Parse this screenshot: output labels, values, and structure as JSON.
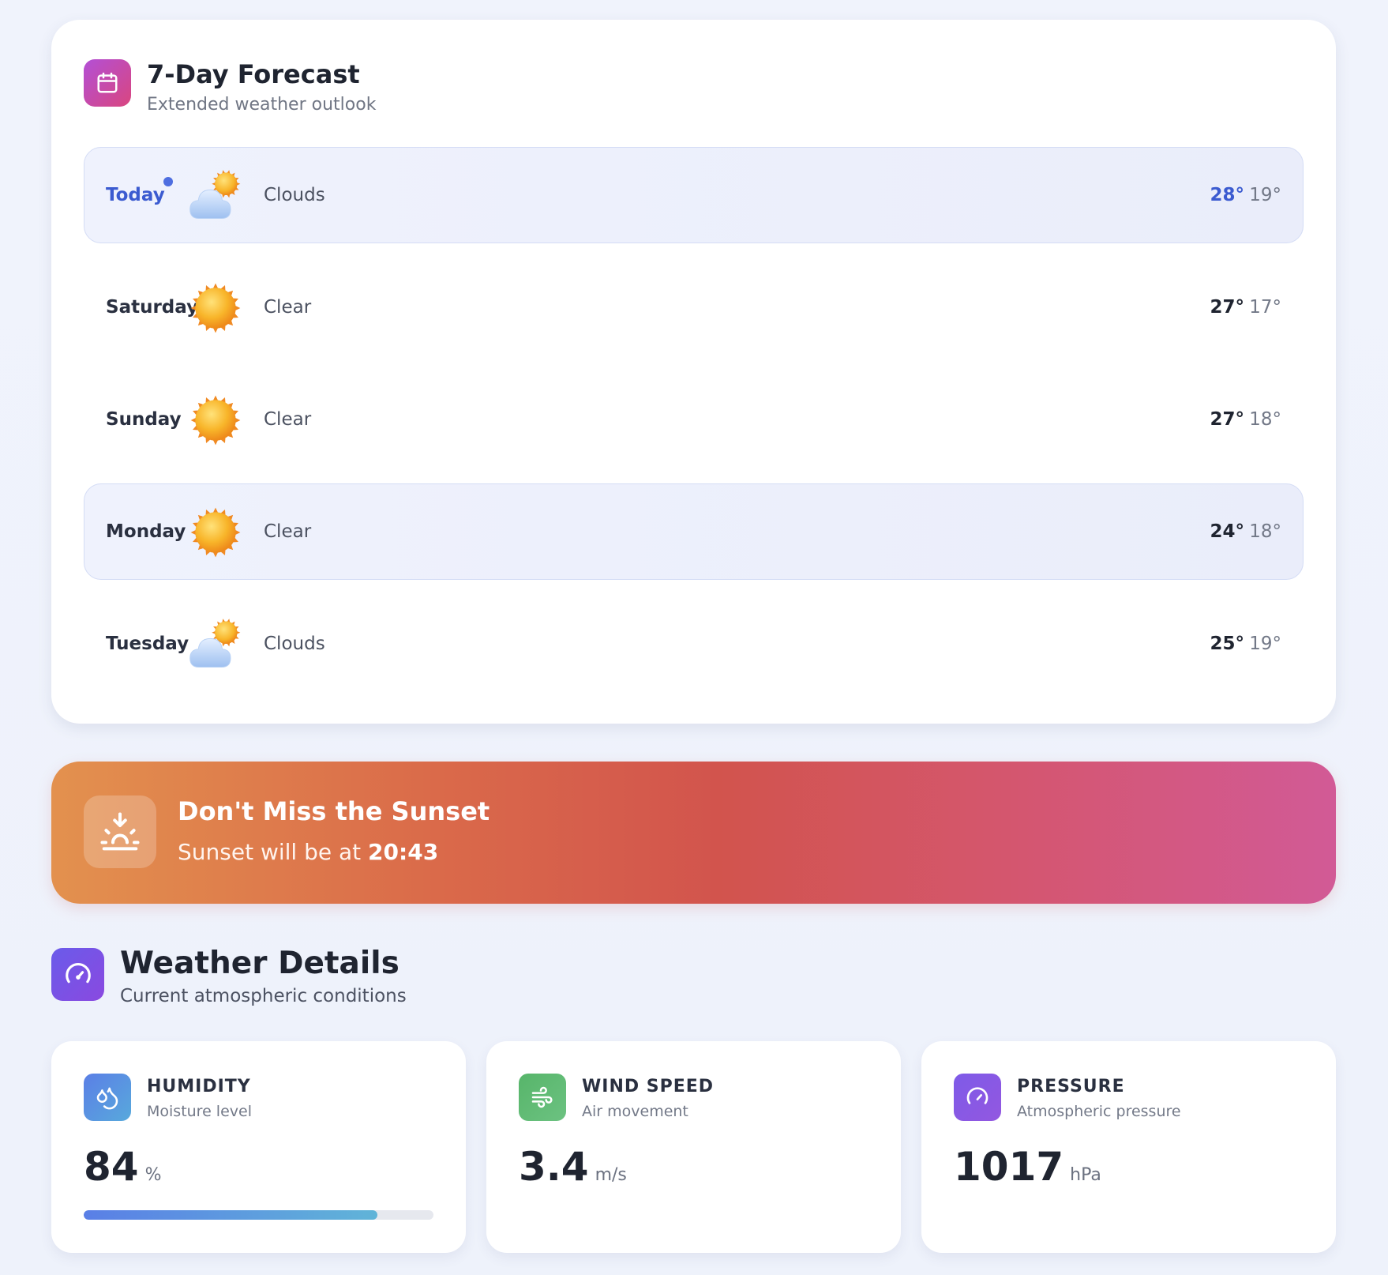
{
  "forecast": {
    "title": "7-Day Forecast",
    "subtitle": "Extended weather outlook",
    "icon": "calendar-icon",
    "days": [
      {
        "day": "Today",
        "condition": "Clouds",
        "icon": "partly-cloudy-icon",
        "high": "28°",
        "low": "19°",
        "highlighted": true,
        "is_today": true
      },
      {
        "day": "Saturday",
        "condition": "Clear",
        "icon": "sun-icon",
        "high": "27°",
        "low": "17°",
        "highlighted": false,
        "is_today": false
      },
      {
        "day": "Sunday",
        "condition": "Clear",
        "icon": "sun-icon",
        "high": "27°",
        "low": "18°",
        "highlighted": false,
        "is_today": false
      },
      {
        "day": "Monday",
        "condition": "Clear",
        "icon": "sun-icon",
        "high": "24°",
        "low": "18°",
        "highlighted": true,
        "is_today": false
      },
      {
        "day": "Tuesday",
        "condition": "Clouds",
        "icon": "partly-cloudy-icon",
        "high": "25°",
        "low": "19°",
        "highlighted": false,
        "is_today": false
      }
    ]
  },
  "sunset": {
    "title": "Don't Miss the Sunset",
    "text_prefix": "Sunset will be at",
    "time": "20:43",
    "icon": "sunset-icon",
    "gradient": [
      "#e3914e",
      "#d2544d",
      "#d25a96"
    ]
  },
  "details": {
    "title": "Weather Details",
    "subtitle": "Current atmospheric conditions",
    "icon": "gauge-icon",
    "metrics": [
      {
        "title": "HUMIDITY",
        "subtitle": "Moisture level",
        "value": "84",
        "unit": "%",
        "icon": "droplets-icon",
        "color": "#5b86e0",
        "progress": 0.84
      },
      {
        "title": "WIND SPEED",
        "subtitle": "Air movement",
        "value": "3.4",
        "unit": "m/s",
        "icon": "wind-icon",
        "color": "#5dbb6f"
      },
      {
        "title": "PRESSURE",
        "subtitle": "Atmospheric pressure",
        "value": "1017",
        "unit": "hPa",
        "icon": "gauge-icon",
        "color": "#7f5ae8"
      }
    ]
  }
}
